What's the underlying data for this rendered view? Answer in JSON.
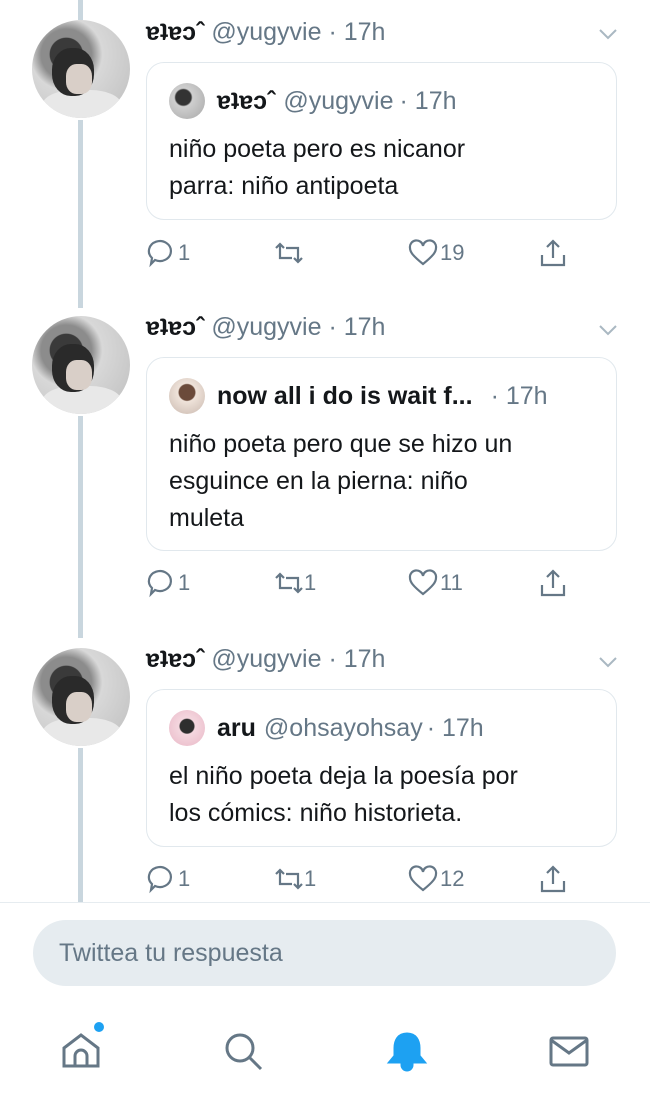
{
  "tweets": [
    {
      "name": "ɐʇɐɔ",
      "mark": "ˆ",
      "handle": "@yugyvie",
      "time": "· 17h",
      "quote": {
        "name": "ɐʇɐɔ",
        "mark": "ˆ",
        "handle": "@yugyvie",
        "time": "· 17h",
        "text": "niño poeta pero es nicanor\nparra: niño antipoeta"
      },
      "replies": "1",
      "retweets": "",
      "likes": "19"
    },
    {
      "name": "ɐʇɐɔ",
      "mark": "ˆ",
      "handle": "@yugyvie",
      "time": "· 17h",
      "quote": {
        "name": "now all i do is wait f...",
        "mark": "",
        "handle": "",
        "time": "· 17h",
        "text": "niño poeta pero que se hizo un\nesguince en la pierna: niño\nmuleta"
      },
      "replies": "1",
      "retweets": "1",
      "likes": "11"
    },
    {
      "name": "ɐʇɐɔ",
      "mark": "ˆ",
      "handle": "@yugyvie",
      "time": "· 17h",
      "quote": {
        "name": "aru",
        "mark": "",
        "handle": "@ohsayohsay",
        "time": "· 17h",
        "text": "el niño poeta deja la poesía por\nlos cómics: niño historieta."
      },
      "replies": "1",
      "retweets": "1",
      "likes": "12"
    }
  ],
  "reply": {
    "placeholder": "Twittea tu respuesta"
  },
  "tabs": [
    {
      "icon": "home-icon",
      "active": false,
      "has_notification_dot": true
    },
    {
      "icon": "search-icon",
      "active": false
    },
    {
      "icon": "bell-icon",
      "active": true
    },
    {
      "icon": "mail-icon",
      "active": false
    }
  ],
  "colors": {
    "accent": "#1da1f2",
    "muted": "#657786",
    "thread": "#c9d6de"
  }
}
